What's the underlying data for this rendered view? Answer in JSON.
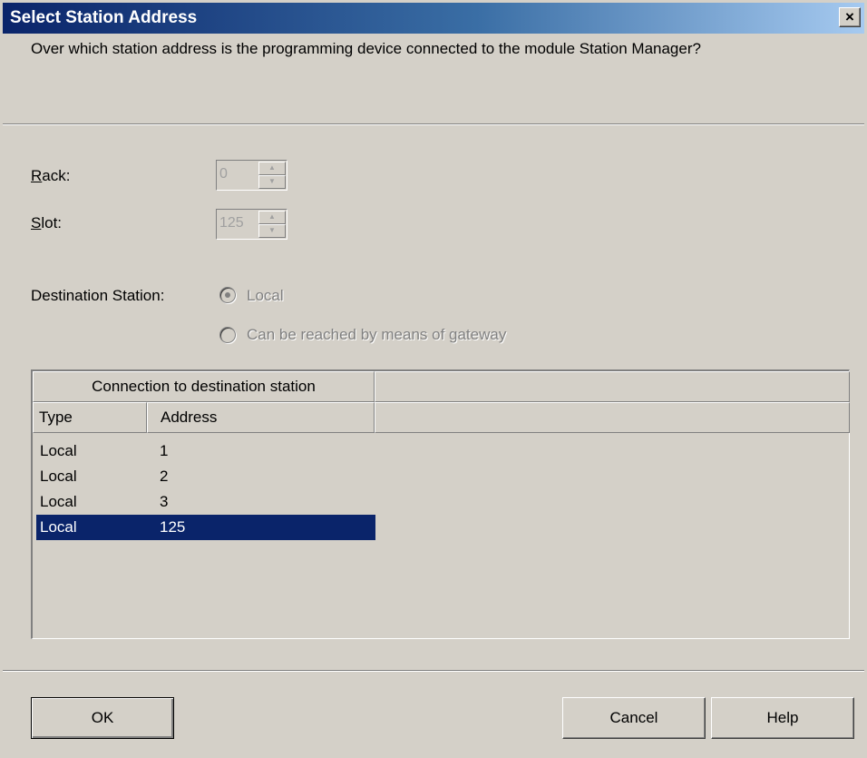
{
  "window": {
    "title": "Select Station Address",
    "close_label": "×"
  },
  "question": "Over which station address is the programming device connected to the module Station Manager?",
  "rack": {
    "label": "Rack:",
    "value": "0"
  },
  "slot": {
    "label": "Slot:",
    "value": "125"
  },
  "destination": {
    "label": "Destination Station:",
    "options": [
      {
        "label": "Local",
        "selected": true
      },
      {
        "label": "Can be reached by means of gateway",
        "selected": false
      }
    ]
  },
  "table": {
    "group_header": "Connection to destination station",
    "columns": [
      "Type",
      "Address"
    ],
    "rows": [
      {
        "type": "Local",
        "address": "1"
      },
      {
        "type": "Local",
        "address": "2"
      },
      {
        "type": "Local",
        "address": "3"
      },
      {
        "type": "Local",
        "address": "125",
        "selected": true
      }
    ]
  },
  "buttons": {
    "ok": "OK",
    "cancel": "Cancel",
    "help": "Help"
  },
  "colors": {
    "selection": "#0a246a",
    "face": "#d4d0c8",
    "title_start": "#0a246a"
  }
}
